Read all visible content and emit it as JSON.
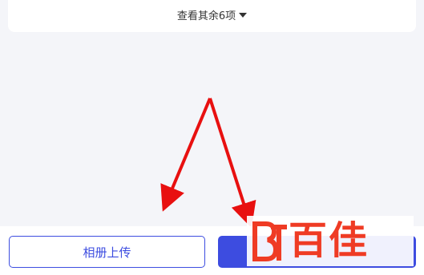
{
  "expand_link": {
    "label": "查看其余6项"
  },
  "buttons": {
    "album_upload": "相册上传",
    "primary": ""
  },
  "watermark": {
    "text": "百佳"
  },
  "colors": {
    "accent": "#3d4de0",
    "arrow": "#e81010",
    "watermark": "#ef3b24",
    "background": "#f4f5f9"
  }
}
